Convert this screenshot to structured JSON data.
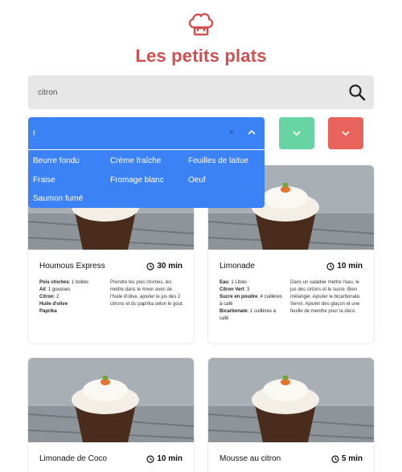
{
  "header": {
    "title": "Les petits plats",
    "logo_icon": "chef-hat-icon"
  },
  "search": {
    "value": "citron",
    "icon": "search-icon"
  },
  "filter": {
    "value": "f",
    "clear_symbol": "×",
    "color": "#3b82f6",
    "options": [
      "Beurre fondu",
      "Crème fraîche",
      "Feuilles de laitue",
      "Fraise",
      "Fromage blanc",
      "Oeuf",
      "Saumon fumé"
    ]
  },
  "filter_buttons": {
    "green": "#68d4a4",
    "red": "#e8635b"
  },
  "recipes": [
    {
      "name": "Houmous Express",
      "time": "30 min",
      "ingredients": [
        {
          "name": "Pois chiches",
          "qty": ": 1 boites"
        },
        {
          "name": "Ail",
          "qty": ": 1 gousses"
        },
        {
          "name": "Citron",
          "qty": ": 2"
        },
        {
          "name": "Huile d'olive",
          "qty": ""
        },
        {
          "name": "Paprika",
          "qty": ""
        }
      ],
      "description": "Prendre les pois chiches, les mettre dans le mixer avec de l'huile d'olive, ajouter le jus des 2 citrons et du paprika selon le gout."
    },
    {
      "name": "Limonade",
      "time": "10 min",
      "ingredients": [
        {
          "name": "Eau",
          "qty": ": 1 Litres"
        },
        {
          "name": "Citron Vert",
          "qty": ": 3"
        },
        {
          "name": "Sucre en poudre",
          "qty": ": 4 cuillères à café"
        },
        {
          "name": "Bicarbonate",
          "qty": ": 1 cuillères à café"
        }
      ],
      "description": "Dans un saladier mettre l'eau, le jus des cirtons et le sucre. Bien mélanger. Ajouter le bicarbonate. Servir. Ajouter des glaçon et une feuille de menthe pour la déco."
    },
    {
      "name": "Limonade de Coco",
      "time": "10 min",
      "ingredients": [],
      "description": ""
    },
    {
      "name": "Mousse au citron",
      "time": "5 min",
      "ingredients": [],
      "description": ""
    }
  ]
}
